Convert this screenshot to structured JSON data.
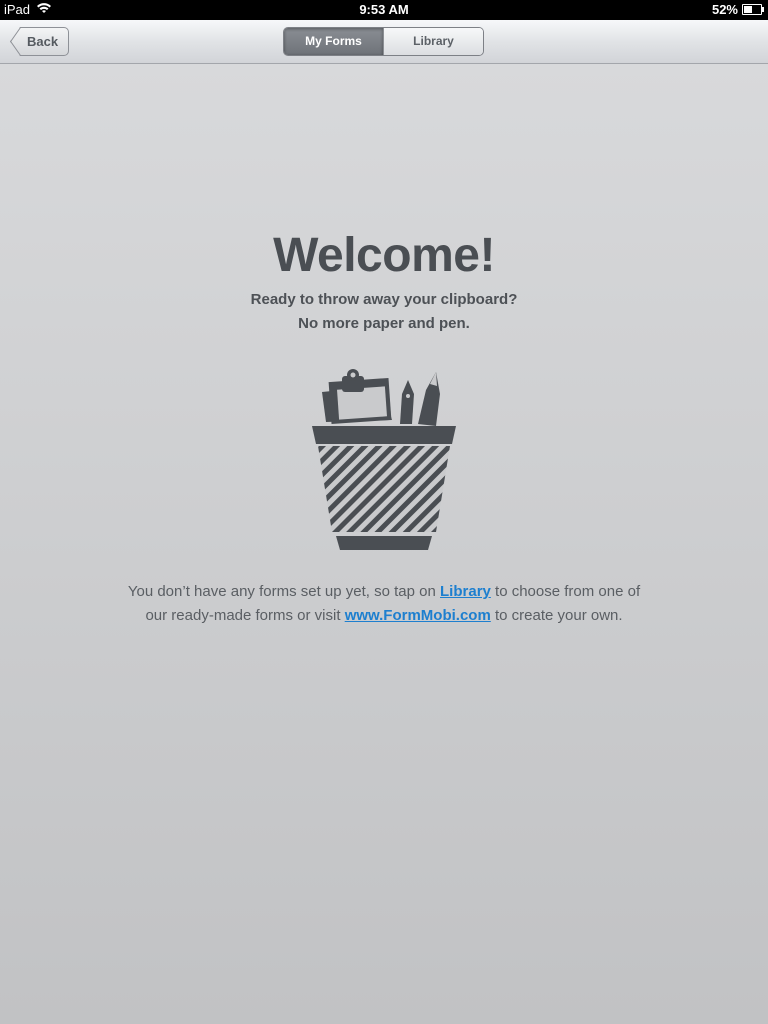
{
  "status_bar": {
    "device": "iPad",
    "time": "9:53 AM",
    "battery": "52%",
    "battery_level": 0.52,
    "wifi_icon": "wifi-icon",
    "battery_icon": "battery-icon"
  },
  "nav": {
    "back_label": "Back",
    "segments": [
      {
        "label": "My Forms",
        "selected": true
      },
      {
        "label": "Library",
        "selected": false
      }
    ]
  },
  "welcome": {
    "title": "Welcome!",
    "line1": "Ready to throw away your clipboard?",
    "line2": "No more paper and pen.",
    "illustration_icon": "pencil-cup-icon"
  },
  "info": {
    "part1": "You don’t have any forms set up yet, so tap on ",
    "link1": "Library",
    "part2": " to choose from one of our ready-made forms or visit ",
    "link2": "www.FormMobi.com",
    "part3": " to create your own."
  },
  "colors": {
    "link": "#1d7fcf",
    "text_dark": "#4a4e53",
    "background_top": "#d8d9db",
    "background_bottom": "#c1c2c4"
  }
}
